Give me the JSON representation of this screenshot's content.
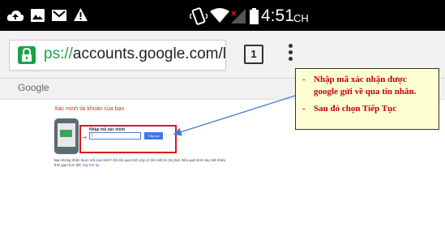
{
  "status_bar": {
    "time": "4:51",
    "time_suffix": "CH"
  },
  "browser": {
    "url_scheme": "ps://",
    "url_rest": "accounts.google.com/l",
    "tab_count": "1"
  },
  "page": {
    "google_logo": "Google",
    "verify_title": "Xác minh tài khoản của bạn",
    "input_label": "Nhập mã xác minh",
    "code_value": "|",
    "continue_label": "Tiếp tục",
    "help_line1": "Bạn không nhận được mã của mình? Đôi khi quá trình này có thể mất tới 15 phút. Nếu quá trình này mất nhiều",
    "help_line2_prefix": "thời gian hơn thế, ",
    "help_line2_link": "hãy thử lại."
  },
  "callout": {
    "bullet1": "-",
    "line1": "Nhập mã xác nhận được",
    "line2": "google gửi về qua tin nhắn.",
    "bullet2": "-",
    "line3": "Sau đó chọn Tiếp Tục"
  },
  "colors": {
    "accent_green": "#1aa34a",
    "highlight_red": "#e0141b",
    "callout_text": "#c00000",
    "callout_bg": "#ffffd4",
    "arrow_blue": "#3f7fd0"
  }
}
